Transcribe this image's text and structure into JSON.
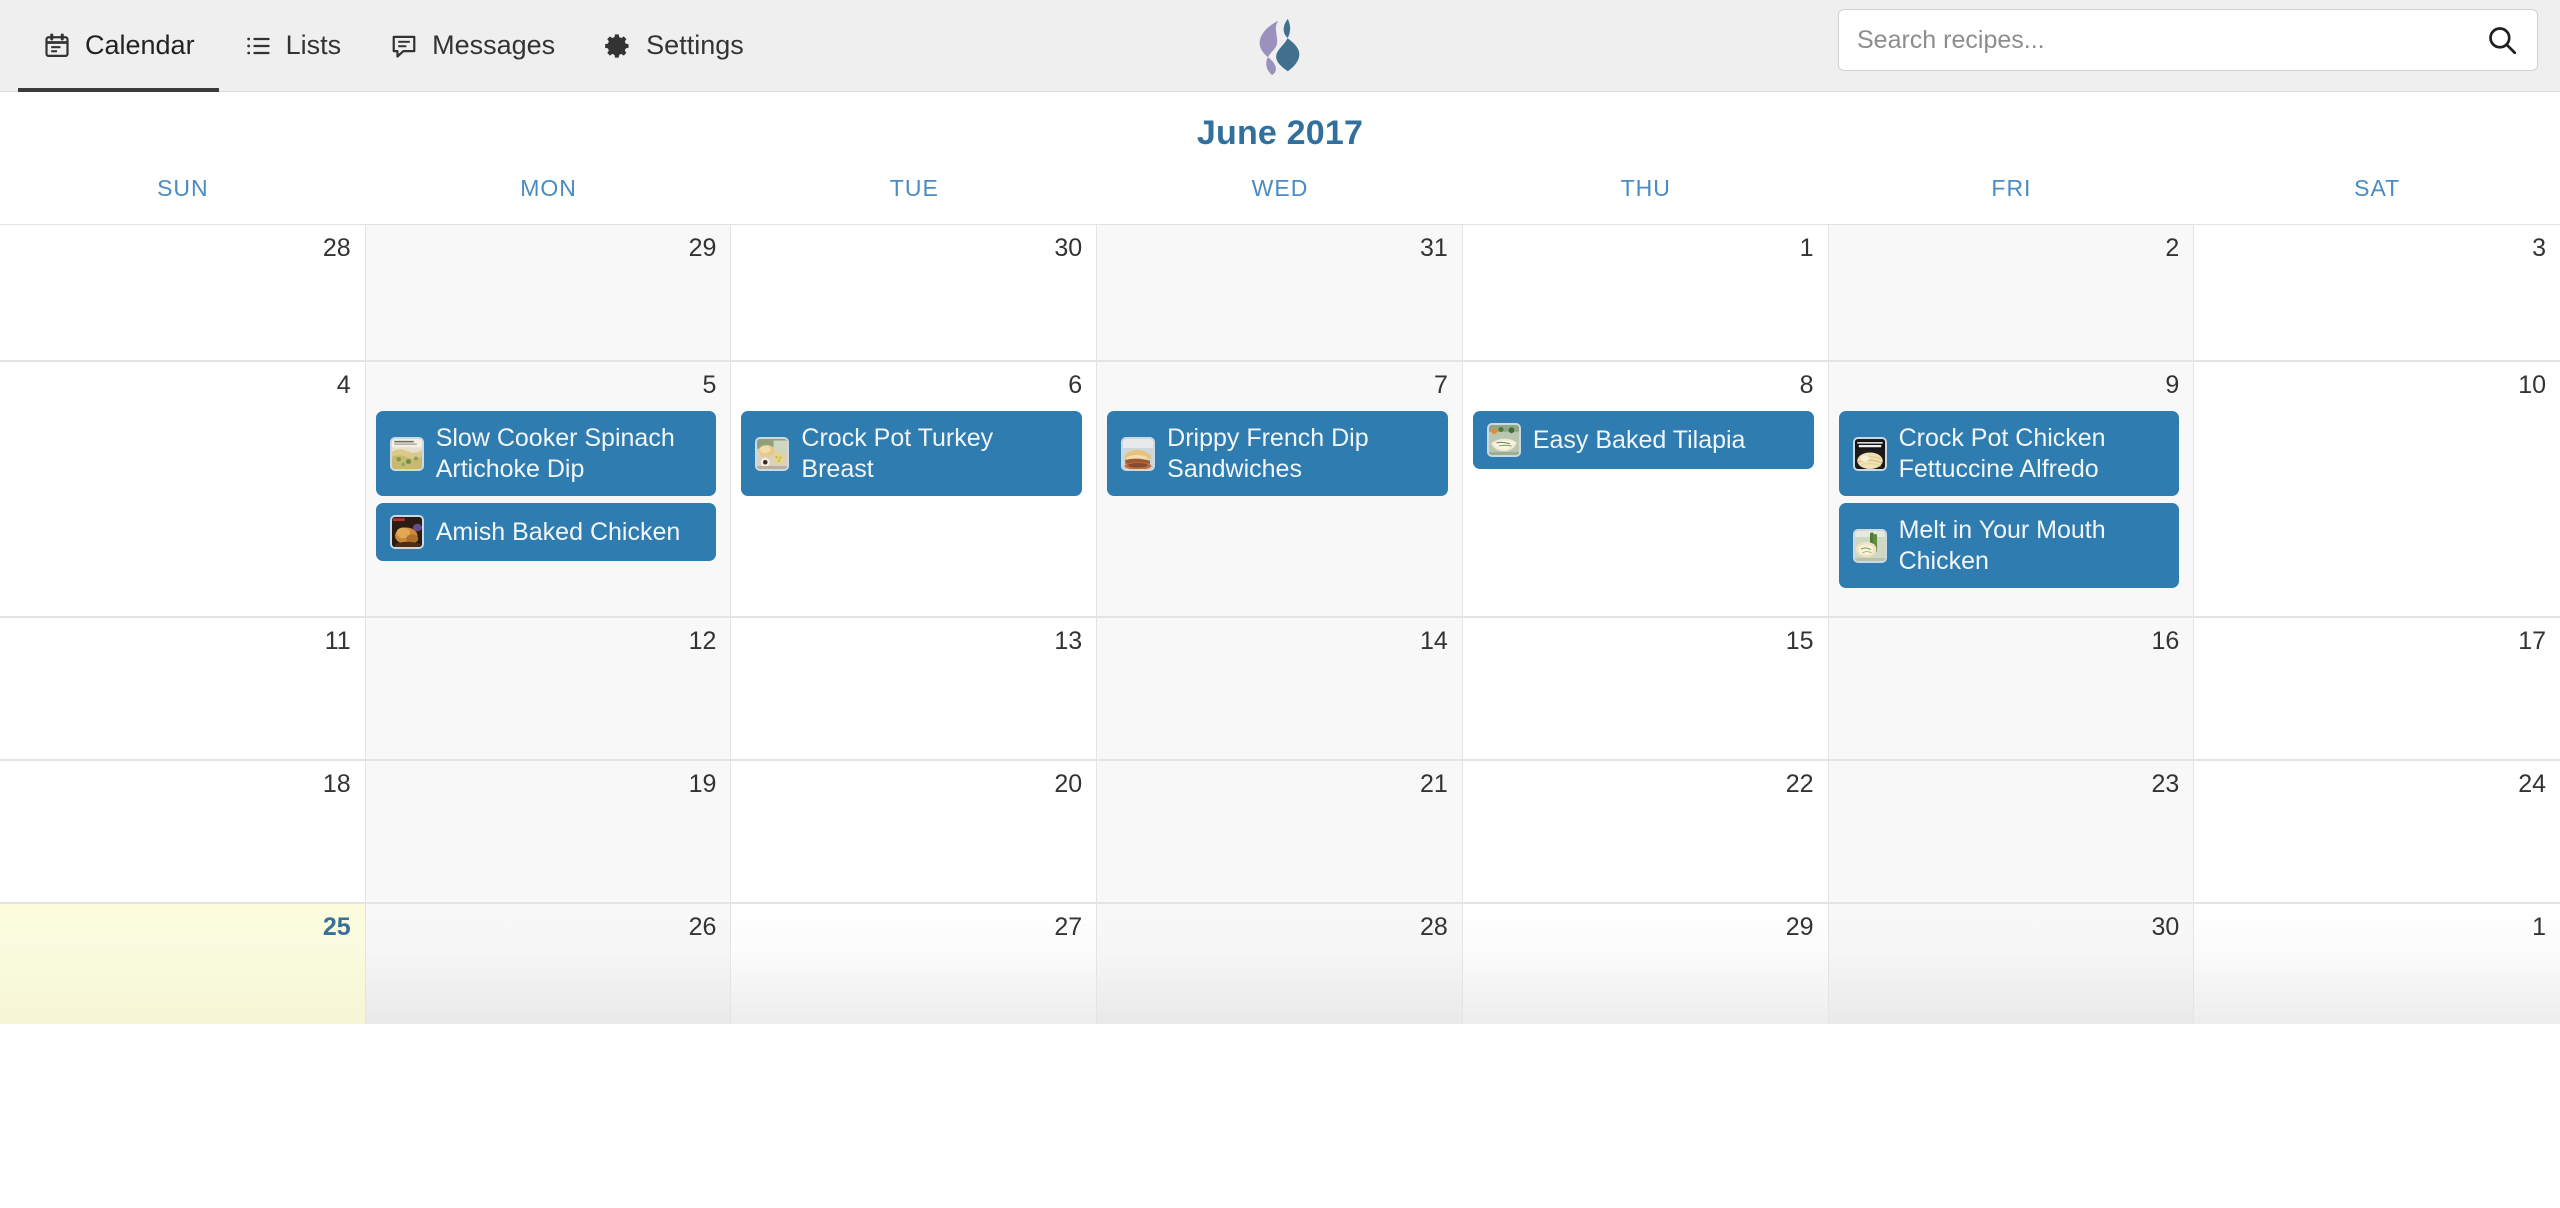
{
  "nav": {
    "tabs": [
      {
        "label": "Calendar",
        "icon": "calendar-icon",
        "active": true
      },
      {
        "label": "Lists",
        "icon": "list-icon",
        "active": false
      },
      {
        "label": "Messages",
        "icon": "message-icon",
        "active": false
      },
      {
        "label": "Settings",
        "icon": "gear-icon",
        "active": false
      }
    ]
  },
  "logo": {
    "name": "swirl-s-logo",
    "color_left": "#9b91bd",
    "color_right": "#41708f"
  },
  "search": {
    "placeholder": "Search recipes...",
    "value": "",
    "icon": "search-icon"
  },
  "calendar": {
    "month_title": "June 2017",
    "title_color": "#31709c",
    "weekday_color": "#4a8bc2",
    "event_color": "#2e7cb0",
    "today_color": "#fcfcdd",
    "weekdays": [
      "SUN",
      "MON",
      "TUE",
      "WED",
      "THU",
      "FRI",
      "SAT"
    ],
    "weeks": [
      {
        "days": [
          {
            "num": "28",
            "today": false,
            "events": []
          },
          {
            "num": "29",
            "today": false,
            "events": []
          },
          {
            "num": "30",
            "today": false,
            "events": []
          },
          {
            "num": "31",
            "today": false,
            "events": []
          },
          {
            "num": "1",
            "today": false,
            "events": []
          },
          {
            "num": "2",
            "today": false,
            "events": []
          },
          {
            "num": "3",
            "today": false,
            "events": []
          }
        ]
      },
      {
        "days": [
          {
            "num": "4",
            "today": false,
            "events": []
          },
          {
            "num": "5",
            "today": false,
            "events": [
              {
                "title": "Slow Cooker Spinach Artichoke Dip",
                "thumb": "spinach-artichoke-dip-thumb"
              },
              {
                "title": "Amish Baked Chicken",
                "thumb": "amish-baked-chicken-thumb"
              }
            ]
          },
          {
            "num": "6",
            "today": false,
            "events": [
              {
                "title": "Crock Pot Turkey Breast",
                "thumb": "crock-pot-turkey-breast-thumb"
              }
            ]
          },
          {
            "num": "7",
            "today": false,
            "events": [
              {
                "title": "Drippy French Dip Sandwiches",
                "thumb": "french-dip-sandwiches-thumb"
              }
            ]
          },
          {
            "num": "8",
            "today": false,
            "events": [
              {
                "title": "Easy Baked Tilapia",
                "thumb": "easy-baked-tilapia-thumb"
              }
            ]
          },
          {
            "num": "9",
            "today": false,
            "events": [
              {
                "title": "Crock Pot Chicken Fettuccine Alfredo",
                "thumb": "chicken-fettuccine-alfredo-thumb"
              },
              {
                "title": "Melt in Your Mouth Chicken",
                "thumb": "melt-in-your-mouth-chicken-thumb"
              }
            ]
          },
          {
            "num": "10",
            "today": false,
            "events": []
          }
        ]
      },
      {
        "days": [
          {
            "num": "11",
            "today": false,
            "events": []
          },
          {
            "num": "12",
            "today": false,
            "events": []
          },
          {
            "num": "13",
            "today": false,
            "events": []
          },
          {
            "num": "14",
            "today": false,
            "events": []
          },
          {
            "num": "15",
            "today": false,
            "events": []
          },
          {
            "num": "16",
            "today": false,
            "events": []
          },
          {
            "num": "17",
            "today": false,
            "events": []
          }
        ]
      },
      {
        "days": [
          {
            "num": "18",
            "today": false,
            "events": []
          },
          {
            "num": "19",
            "today": false,
            "events": []
          },
          {
            "num": "20",
            "today": false,
            "events": []
          },
          {
            "num": "21",
            "today": false,
            "events": []
          },
          {
            "num": "22",
            "today": false,
            "events": []
          },
          {
            "num": "23",
            "today": false,
            "events": []
          },
          {
            "num": "24",
            "today": false,
            "events": []
          }
        ]
      },
      {
        "days": [
          {
            "num": "25",
            "today": true,
            "events": []
          },
          {
            "num": "26",
            "today": false,
            "events": []
          },
          {
            "num": "27",
            "today": false,
            "events": []
          },
          {
            "num": "28",
            "today": false,
            "events": []
          },
          {
            "num": "29",
            "today": false,
            "events": []
          },
          {
            "num": "30",
            "today": false,
            "events": []
          },
          {
            "num": "1",
            "today": false,
            "events": []
          }
        ]
      }
    ]
  }
}
